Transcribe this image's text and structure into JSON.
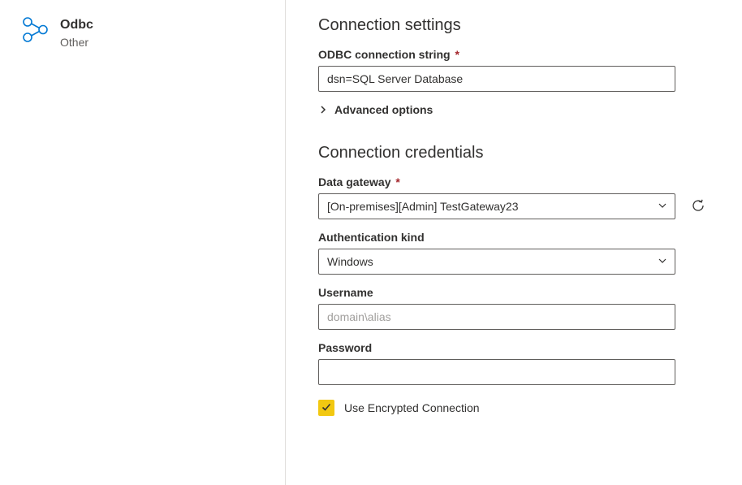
{
  "sidebar": {
    "connector_title": "Odbc",
    "connector_subtitle": "Other"
  },
  "settings": {
    "heading": "Connection settings",
    "connection_string": {
      "label": "ODBC connection string",
      "required_mark": "*",
      "value": "dsn=SQL Server Database"
    },
    "advanced_label": "Advanced options"
  },
  "credentials": {
    "heading": "Connection credentials",
    "gateway": {
      "label": "Data gateway",
      "required_mark": "*",
      "value": "[On-premises][Admin] TestGateway23"
    },
    "auth_kind": {
      "label": "Authentication kind",
      "value": "Windows"
    },
    "username": {
      "label": "Username",
      "placeholder": "domain\\alias",
      "value": ""
    },
    "password": {
      "label": "Password",
      "value": ""
    },
    "encrypted": {
      "label": "Use Encrypted Connection",
      "checked": true
    }
  },
  "icons": {
    "accent_color": "#0078d4",
    "checkbox_color": "#f2c811"
  }
}
